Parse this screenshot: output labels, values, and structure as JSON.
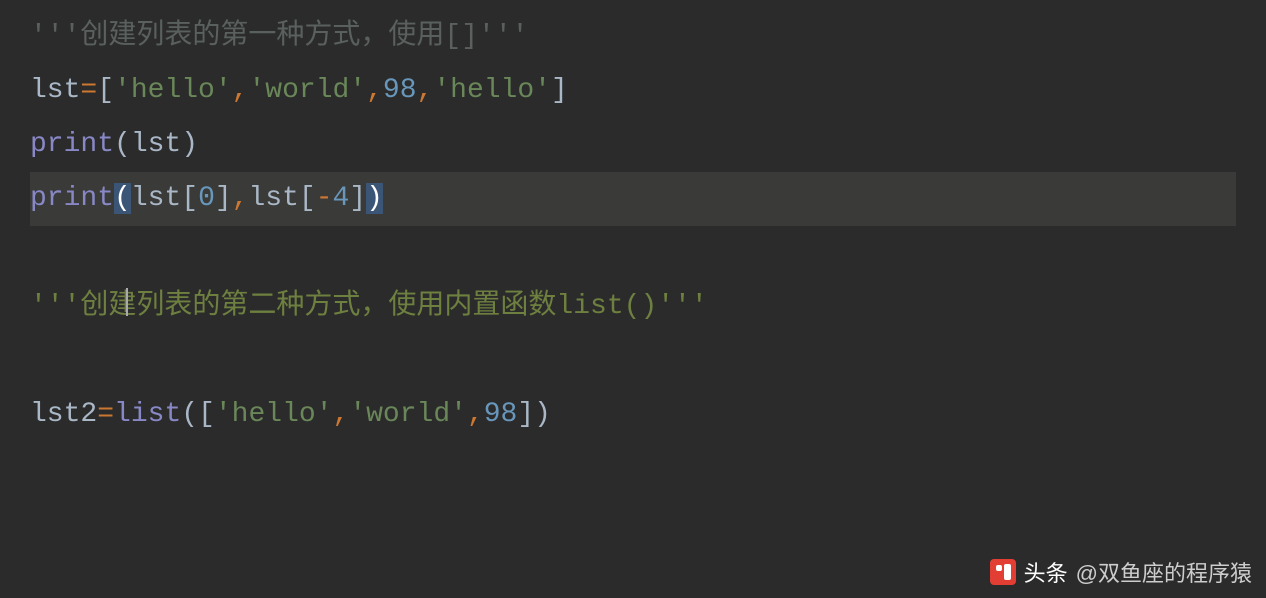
{
  "code": {
    "line1": {
      "quote_open": "'''",
      "text": "创建列表的第一种方式，使用[]",
      "quote_close": "'''"
    },
    "line2": {
      "var": "lst",
      "eq": "=",
      "lb": "[",
      "s1": "'hello'",
      "c1": ",",
      "s2": "'world'",
      "c2": ",",
      "n1": "98",
      "c3": ",",
      "s3": "'hello'",
      "rb": "]"
    },
    "line3": {
      "fn": "print",
      "lp": "(",
      "arg": "lst",
      "rp": ")"
    },
    "line4": {
      "fn": "print",
      "lp": "(",
      "a1": "lst",
      "lb1": "[",
      "i1": "0",
      "rb1": "]",
      "comma": ",",
      "a2": "lst",
      "lb2": "[",
      "neg": "-",
      "i2": "4",
      "rb2": "]",
      "rp": ")"
    },
    "line6": {
      "quote_open": "'''",
      "text": "创建列表的第二种方式，使用内置函数list()",
      "quote_close": "'''"
    },
    "line8": {
      "var": "lst2",
      "eq": "=",
      "fn": "list",
      "lp": "(",
      "lb": "[",
      "s1": "'hello'",
      "c1": ",",
      "s2": "'world'",
      "c2": ",",
      "n1": "98",
      "rb": "]",
      "rp": ")"
    }
  },
  "watermark": {
    "brand": "头条",
    "author": "@双鱼座的程序猿"
  }
}
